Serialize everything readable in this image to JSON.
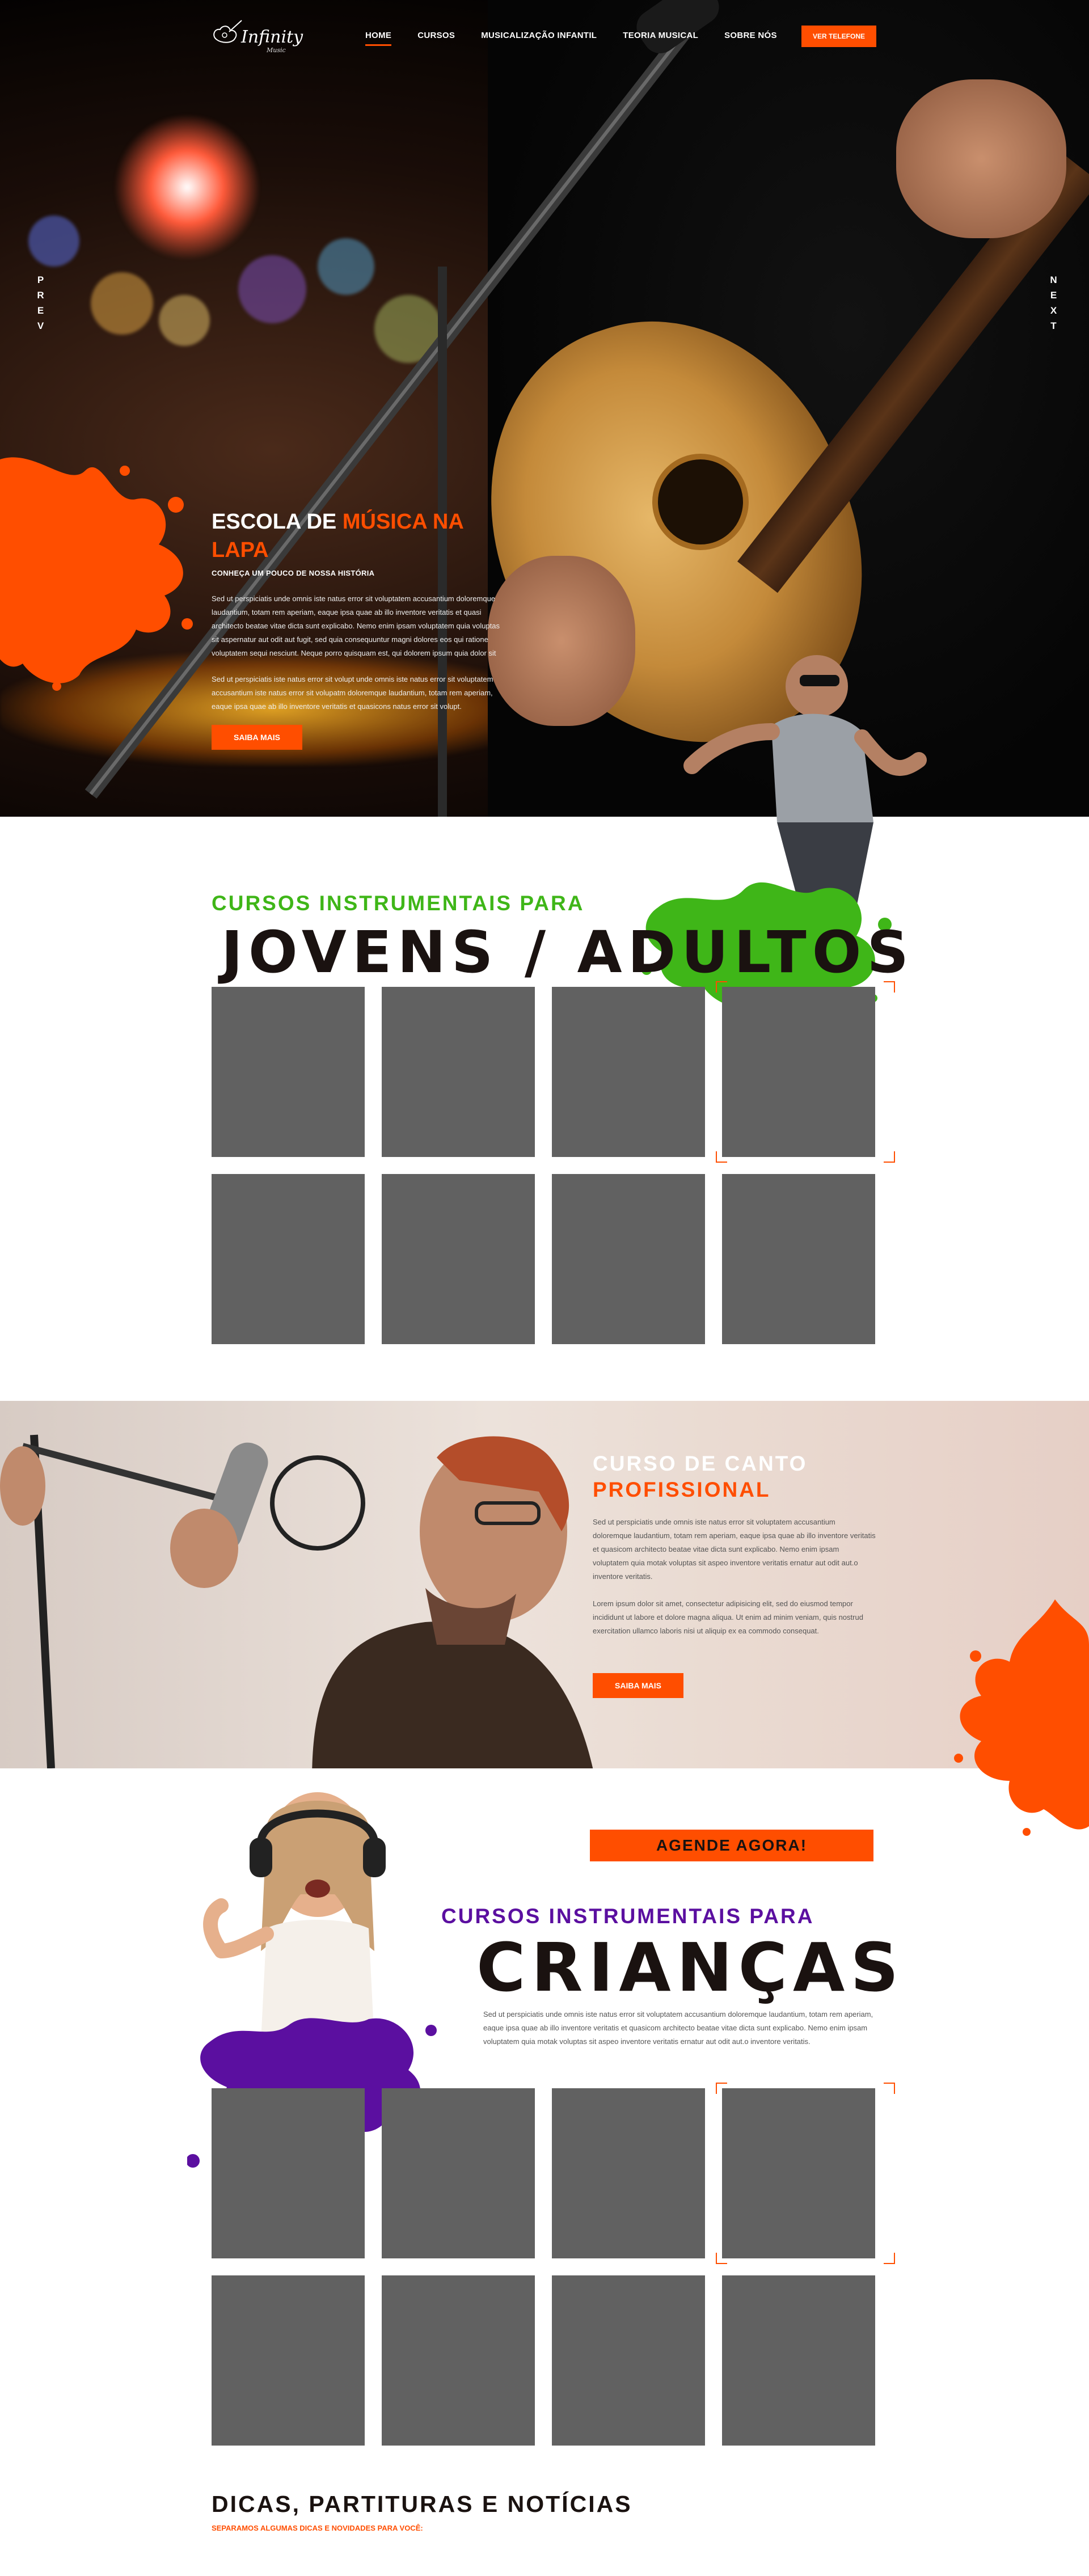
{
  "colors": {
    "accent": "#ff4e00",
    "green": "#3fb618",
    "purple": "#5b0fa0",
    "card": "#616161",
    "dark": "#1a1210"
  },
  "brand": {
    "logo_text": "Infinity",
    "logo_sub": "Music"
  },
  "nav": {
    "items": [
      {
        "label": "HOME",
        "active": true
      },
      {
        "label": "CURSOS",
        "active": false
      },
      {
        "label": "MUSICALIZAÇÃO INFANTIL",
        "active": false
      },
      {
        "label": "TEORIA MUSICAL",
        "active": false
      },
      {
        "label": "SOBRE NÓS",
        "active": false
      }
    ],
    "phone_button": "VER TELEFONE"
  },
  "slider": {
    "prev": "PREV",
    "next": "NEXT"
  },
  "hero": {
    "title_plain": "ESCOLA DE ",
    "title_accent": "MÚSICA NA LAPA",
    "subtitle": "CONHEÇA UM POUCO DE NOSSA HISTÓRIA",
    "p1": "Sed ut perspiciatis unde omnis iste natus error sit voluptatem accusantium doloremque laudantium, totam rem aperiam, eaque ipsa quae ab illo inventore veritatis et quasi architecto beatae vitae dicta sunt explicabo. Nemo enim ipsam voluptatem quia voluptas sit aspernatur aut odit aut fugit, sed quia consequuntur magni dolores eos qui ratione voluptatem sequi nesciunt. Neque porro quisquam est, qui dolorem ipsum quia dolor sit amet, consectetur, adipisci velit, sed quia non numquam eius modi tempora incidunt ut labore et dolore magnam aliquam quaerat voluptatem. Ut enim ad minima veniam, quis nostrum exercitationem ullam corporis suscipit laboriosam, nisi ut aliquid ex ea commodi consequatur? Quis autem vel eum iure reprehenderit qui in ea voluptate velit esse quam nihil molestiae consequatur, vel illum qui dolorem eum fugiat quo voluptas nulla pariatur? At vero eos et accusamus et iusto odio dignissimos ducimus qui blanditiis praesentium voluptatum deleniti atque corrupti quos dolores et quas molestias excepturi sint occaecati cupiditate non provident.",
    "p2": "Sed ut perspiciatis iste natus error sit volupt unde omnis iste natus error sit voluptatem accusantium iste natus error sit volupatm doloremque laudantium, totam rem aperiam, eaque ipsa quae ab illo inventore veritatis et quasicons natus error sit volupt.",
    "button": "SAIBA MAIS"
  },
  "adults": {
    "label": "CURSOS INSTRUMENTAIS PARA",
    "title": "JOVENS / ADULTOS",
    "cards": [
      "",
      "",
      "",
      "",
      "",
      "",
      "",
      ""
    ]
  },
  "singing": {
    "title1": "CURSO DE CANTO",
    "title2": "PROFISSIONAL",
    "p1": "Sed ut perspiciatis unde omnis iste natus error sit voluptatem accusantium doloremque laudantium, totam rem aperiam, eaque ipsa quae ab illo inventore veritatis et quasicom architecto beatae vitae dicta sunt explicabo. Nemo enim ipsam voluptatem quia motak voluptas sit aspeo inventore veritatis ernatur aut odit aut.o inventore veritatis.",
    "p2": "Lorem ipsum dolor sit amet, consectetur adipisicing elit, sed do eiusmod tempor incididunt ut labore et dolore magna aliqua. Ut enim ad minim veniam, quis nostrud exercitation ullamco laboris nisi ut aliquip ex ea commodo consequat.",
    "button": "SAIBA MAIS"
  },
  "kids": {
    "cta": "AGENDE AGORA!",
    "label": "CURSOS INSTRUMENTAIS PARA",
    "title": "CRIANÇAS",
    "p": "Sed ut perspiciatis unde omnis iste natus error sit voluptatem accusantium doloremque laudantium, totam rem aperiam, eaque ipsa quae ab illo inventore veritatis et quasicom architecto beatae vitae dicta sunt explicabo. Nemo enim ipsam voluptatem quia motak voluptas sit aspeo inventore veritatis ernatur aut odit aut.o inventore veritatis.",
    "cards": [
      "",
      "",
      "",
      "",
      "",
      "",
      "",
      ""
    ]
  },
  "news": {
    "title": "DICAS, PARTITURAS E NOTÍCIAS",
    "subtitle": "SEPARAMOS ALGUMAS DICAS E NOVIDADES PARA VOCÊ:"
  }
}
